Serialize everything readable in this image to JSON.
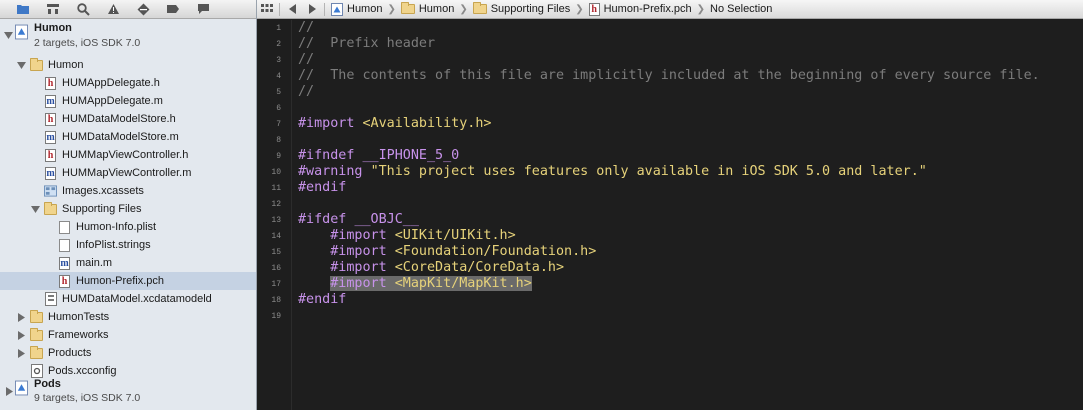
{
  "navigator": {
    "toolbar_icons": [
      "folder-icon",
      "hierarchy-icon",
      "search-icon",
      "warning-icon",
      "test-diamond-icon",
      "breakpoint-icon",
      "log-icon"
    ],
    "project": {
      "name": "Humon",
      "subtitle": "2 targets, iOS SDK 7.0"
    },
    "items": [
      {
        "label": "Humon",
        "kind": "folder",
        "expanded": true
      },
      {
        "label": "HUMAppDelegate.h",
        "kind": "h"
      },
      {
        "label": "HUMAppDelegate.m",
        "kind": "m"
      },
      {
        "label": "HUMDataModelStore.h",
        "kind": "h"
      },
      {
        "label": "HUMDataModelStore.m",
        "kind": "m"
      },
      {
        "label": "HUMMapViewController.h",
        "kind": "h"
      },
      {
        "label": "HUMMapViewController.m",
        "kind": "m"
      },
      {
        "label": "Images.xcassets",
        "kind": "assets"
      },
      {
        "label": "Supporting Files",
        "kind": "folder",
        "expanded": true
      },
      {
        "label": "Humon-Info.plist",
        "kind": "plist"
      },
      {
        "label": "InfoPlist.strings",
        "kind": "strings"
      },
      {
        "label": "main.m",
        "kind": "m"
      },
      {
        "label": "Humon-Prefix.pch",
        "kind": "h",
        "selected": true
      },
      {
        "label": "HUMDataModel.xcdatamodeld",
        "kind": "datamodel"
      },
      {
        "label": "HumonTests",
        "kind": "folder",
        "expanded": false
      },
      {
        "label": "Frameworks",
        "kind": "folder",
        "expanded": false
      },
      {
        "label": "Products",
        "kind": "folder",
        "expanded": false
      },
      {
        "label": "Pods.xcconfig",
        "kind": "config"
      }
    ],
    "pods": {
      "name": "Pods",
      "subtitle": "9 targets, iOS SDK 7.0"
    }
  },
  "jump_bar": {
    "crumbs": [
      "Humon",
      "Humon",
      "Supporting Files",
      "Humon-Prefix.pch",
      "No Selection"
    ]
  },
  "editor": {
    "line_numbers": [
      "1",
      "2",
      "3",
      "4",
      "5",
      "6",
      "7",
      "8",
      "9",
      "10",
      "11",
      "12",
      "13",
      "14",
      "15",
      "16",
      "17",
      "18",
      "19"
    ],
    "lines": {
      "l1": "//",
      "l2": "//  Prefix header",
      "l3": "//",
      "l4": "//  The contents of this file are implicitly included at the beginning of every source file.",
      "l5": "//",
      "l7_kw": "#import",
      "l7_arg": "<Availability.h>",
      "l9_kw": "#ifndef",
      "l9_arg": "__IPHONE_5_0",
      "l10_kw": "#warning",
      "l10_arg": "\"This project uses features only available in iOS SDK 5.0 and later.\"",
      "l11": "#endif",
      "l13_kw": "#ifdef",
      "l13_arg": "__OBJC__",
      "l14_kw": "#import",
      "l14_arg": "<UIKit/UIKit.h>",
      "l15_kw": "#import",
      "l15_arg": "<Foundation/Foundation.h>",
      "l16_kw": "#import",
      "l16_arg": "<CoreData/CoreData.h>",
      "l17_kw": "#import",
      "l17_arg": "<MapKit/MapKit.h>",
      "l18": "#endif"
    }
  },
  "colors": {
    "comment": "#7c7c7c",
    "preprocessor": "#c792ea",
    "string": "#e6d27a",
    "selection": "#6a6a6a",
    "editor_bg": "#1e1e1e"
  }
}
